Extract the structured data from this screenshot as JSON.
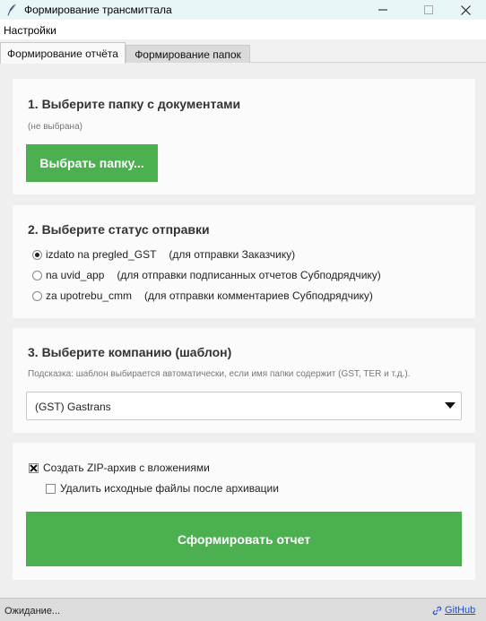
{
  "window": {
    "title": "Формирование трансмиттала",
    "app_icon": "quill-feather-icon"
  },
  "menu": {
    "items": [
      {
        "label": "Настройки"
      }
    ]
  },
  "tabs": [
    {
      "label": "Формирование отчёта",
      "active": true
    },
    {
      "label": "Формирование папок",
      "active": false
    }
  ],
  "section_folder": {
    "heading": "1. Выберите папку с документами",
    "folder_path": "(не выбрана)",
    "button_label": "Выбрать папку..."
  },
  "section_status": {
    "heading": "2. Выберите статус отправки",
    "options": [
      {
        "value": "izdato na pregled_GST",
        "hint": "(для отправки Заказчику)",
        "selected": true
      },
      {
        "value": "na uvid_app",
        "hint": "(для отправки подписанных отчетов Субподрядчику)",
        "selected": false
      },
      {
        "value": "za upotrebu_cmm",
        "hint": "(для отправки комментариев Субподрядчику)",
        "selected": false
      }
    ]
  },
  "section_company": {
    "heading": "3. Выберите компанию (шаблон)",
    "hint": "Подсказка: шаблон выбирается автоматически, если имя папки содержит (GST, TER и т.д.).",
    "selected_template": "(GST) Gastrans"
  },
  "section_options": {
    "zip_label": "Создать ZIP-архив с вложениями",
    "zip_checked": true,
    "delete_label": "Удалить исходные файлы после архивации",
    "delete_checked": false,
    "generate_label": "Сформировать отчет"
  },
  "statusbar": {
    "status": "Ожидание...",
    "link_label": "GitHub",
    "link_icon": "link-icon"
  },
  "colors": {
    "accent_green": "#4caf50",
    "link_blue": "#1b4fd8",
    "titlebar_bg": "#e9f6f8"
  }
}
